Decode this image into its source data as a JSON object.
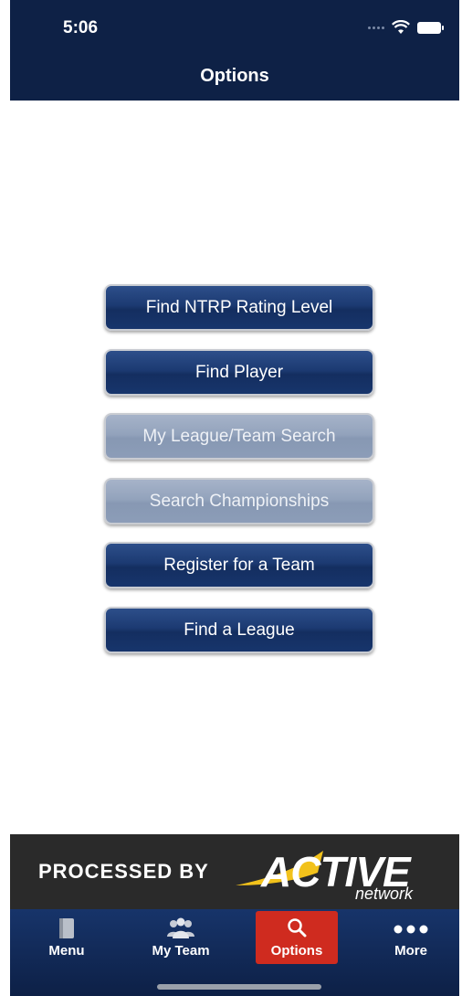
{
  "status_bar": {
    "time": "5:06"
  },
  "header": {
    "title": "Options"
  },
  "options": [
    {
      "label": "Find NTRP Rating Level",
      "enabled": true
    },
    {
      "label": "Find Player",
      "enabled": true
    },
    {
      "label": "My League/Team Search",
      "enabled": false
    },
    {
      "label": "Search Championships",
      "enabled": false
    },
    {
      "label": "Register for a Team",
      "enabled": true
    },
    {
      "label": "Find a League",
      "enabled": true
    }
  ],
  "banner": {
    "processed_by": "PROCESSED BY",
    "logo_word": "ACTIVE",
    "logo_sub": "network"
  },
  "tabbar": {
    "items": [
      {
        "label": "Menu",
        "icon": "menu-book-icon"
      },
      {
        "label": "My Team",
        "icon": "team-icon"
      },
      {
        "label": "Options",
        "icon": "search-icon",
        "active": true
      },
      {
        "label": "More",
        "icon": "more-dots-icon"
      }
    ]
  },
  "colors": {
    "header_bg": "#0e2146",
    "button_primary": "#1c3a72",
    "button_disabled": "#93a3bc",
    "active_tab": "#cf2b1f"
  }
}
